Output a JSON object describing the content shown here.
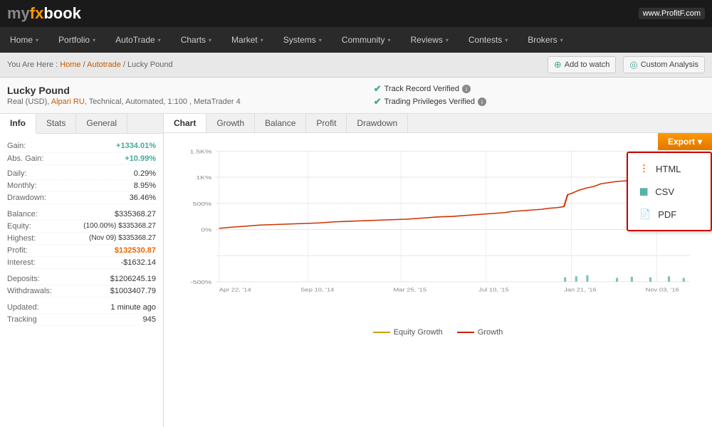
{
  "logo": {
    "my": "my",
    "fx": "fx",
    "book": "book",
    "watermark": "www.ProfitF.com"
  },
  "nav": {
    "items": [
      {
        "label": "Home",
        "arrow": true
      },
      {
        "label": "Portfolio",
        "arrow": true
      },
      {
        "label": "AutoTrade",
        "arrow": true
      },
      {
        "label": "Charts",
        "arrow": true
      },
      {
        "label": "Market",
        "arrow": true
      },
      {
        "label": "Systems",
        "arrow": true
      },
      {
        "label": "Community",
        "arrow": true
      },
      {
        "label": "Reviews",
        "arrow": true
      },
      {
        "label": "Contests",
        "arrow": true
      },
      {
        "label": "Brokers",
        "arrow": true
      }
    ]
  },
  "breadcrumb": {
    "prefix": "You Are Here :",
    "items": [
      "Home",
      "Autotrade",
      "Lucky Pound"
    ],
    "separators": [
      "/",
      "/"
    ]
  },
  "actions": {
    "watch": "Add to watch",
    "analysis": "Custom Analysis"
  },
  "account": {
    "name": "Lucky Pound",
    "details": "Real (USD), Alpari RU, Technical, Automated, 1:100 , MetaTrader 4",
    "badges": [
      "Track Record Verified",
      "Trading Privileges Verified"
    ]
  },
  "info_tabs": [
    "Info",
    "Stats",
    "General"
  ],
  "stats": {
    "gain_label": "Gain:",
    "gain_value": "+1334.01%",
    "abs_gain_label": "Abs. Gain:",
    "abs_gain_value": "+10.99%",
    "daily_label": "Daily:",
    "daily_value": "0.29%",
    "monthly_label": "Monthly:",
    "monthly_value": "8.95%",
    "drawdown_label": "Drawdown:",
    "drawdown_value": "36.46%",
    "balance_label": "Balance:",
    "balance_value": "$335368.27",
    "equity_label": "Equity:",
    "equity_value": "(100.00%) $335368.27",
    "highest_label": "Highest:",
    "highest_value": "(Nov 09) $335368.27",
    "profit_label": "Profit:",
    "profit_value": "$132530.87",
    "interest_label": "Interest:",
    "interest_value": "-$1632.14",
    "deposits_label": "Deposits:",
    "deposits_value": "$1206245.19",
    "withdrawals_label": "Withdrawals:",
    "withdrawals_value": "$1003407.79",
    "updated_label": "Updated:",
    "updated_value": "1 minute ago",
    "tracking_label": "Tracking",
    "tracking_value": "945"
  },
  "chart_tabs": [
    "Chart",
    "Growth",
    "Balance",
    "Profit",
    "Drawdown"
  ],
  "export": {
    "button": "Export",
    "options": [
      "HTML",
      "CSV",
      "PDF"
    ]
  },
  "chart": {
    "y_labels": [
      "1.5K%",
      "1K%",
      "500%",
      "0%",
      "-500%"
    ],
    "x_labels": [
      "Apr 22, '14",
      "Sep 10, '14",
      "Mar 25, '15",
      "Jul 10, '15",
      "Jan 21, '16",
      "Nov 03, '16"
    ]
  },
  "legend": {
    "equity": "Equity Growth",
    "growth": "Growth"
  }
}
